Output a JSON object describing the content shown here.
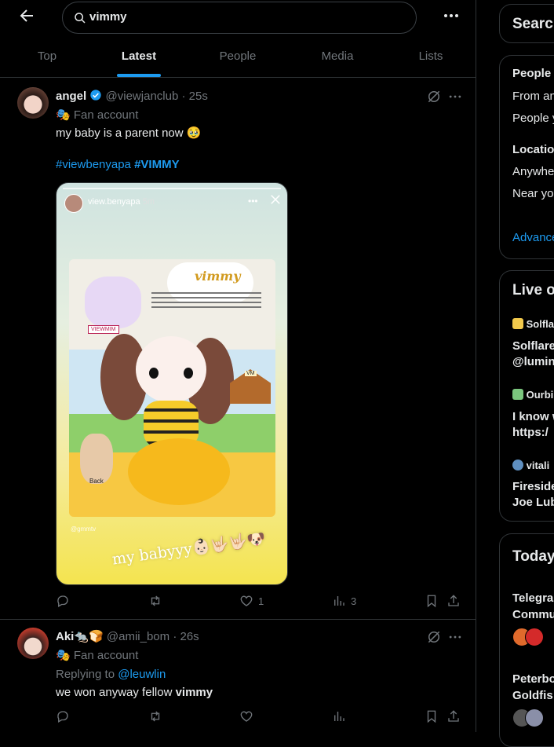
{
  "search": {
    "query": "vimmy"
  },
  "tabs": [
    {
      "label": "Top",
      "active": false
    },
    {
      "label": "Latest",
      "active": true
    },
    {
      "label": "People",
      "active": false
    },
    {
      "label": "Media",
      "active": false
    },
    {
      "label": "Lists",
      "active": false
    }
  ],
  "tweets": [
    {
      "name": "angel",
      "verified": true,
      "handle": "@viewjanclub",
      "time": "25s",
      "fan_label": "Fan account",
      "text": "my baby is a parent now 🥹",
      "hashtag1": "#viewbenyapa",
      "hashtag2": "#VIMMY",
      "likes": "1",
      "views": "3",
      "media": {
        "story_user": "view.benyapa",
        "story_time": "5m",
        "poster_title": "vimmy",
        "poster_tag": "VIEWMIM",
        "doghouse": "VM",
        "back_label": "Back",
        "watermark": "@gmmtv",
        "caption": "my babyyy👶🏻🤟🏻🤟🏻🐶"
      }
    },
    {
      "name": "Aki🐀🍞",
      "handle": "@amii_bom",
      "time": "26s",
      "fan_label": "Fan account",
      "replying_prefix": "Replying to",
      "replying_to": "@leuwlin",
      "text_prefix": "we won anyway fellow",
      "text_bold": "vimmy"
    }
  ],
  "sidebar": {
    "search_heading": "Searc",
    "filters": {
      "people_heading": "People",
      "people_opt1": "From an",
      "people_opt2": "People y",
      "location_heading": "Location",
      "location_opt1": "Anywhe",
      "location_opt2": "Near yo",
      "advanced": "Advance"
    },
    "live_heading": "Live o",
    "live_items": [
      {
        "account": "Solfla",
        "line1": "Solflare",
        "line2": "@lumin"
      },
      {
        "account": "Ourbi",
        "line1": "I know w",
        "line2": "https:/"
      },
      {
        "account": "vitali",
        "line1": "Fireside",
        "line2": "Joe Lub"
      }
    ],
    "today_heading": "Today",
    "today_items": [
      {
        "line1": "Telegra",
        "line2": "Commu"
      },
      {
        "line1": "Peterbo",
        "line2": "Goldfis"
      }
    ]
  },
  "colors": {
    "accent": "#1d9bf0",
    "muted": "#71767b",
    "text": "#e7e9ea",
    "border": "#2f3336"
  }
}
